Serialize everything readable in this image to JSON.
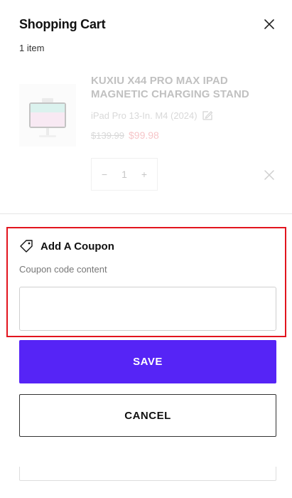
{
  "header": {
    "title": "Shopping Cart",
    "item_count": "1 item",
    "close_icon": "close-icon"
  },
  "cart": {
    "items": [
      {
        "name": "KUXIU X44 PRO MAX IPAD MAGNETIC CHARGING STAND",
        "variant": "iPad Pro 13-In. M4 (2024)",
        "original_price": "$139.99",
        "sale_price": "$99.98",
        "quantity": "1",
        "minus_label": "−",
        "plus_label": "+"
      }
    ]
  },
  "coupon": {
    "title": "Add A Coupon",
    "hint": "Coupon code content",
    "input_value": "",
    "input_placeholder": ""
  },
  "actions": {
    "save_label": "SAVE",
    "cancel_label": "CANCEL"
  },
  "colors": {
    "accent": "#5624f6",
    "sale_red": "#e0303a",
    "highlight_border": "#e2141e"
  }
}
